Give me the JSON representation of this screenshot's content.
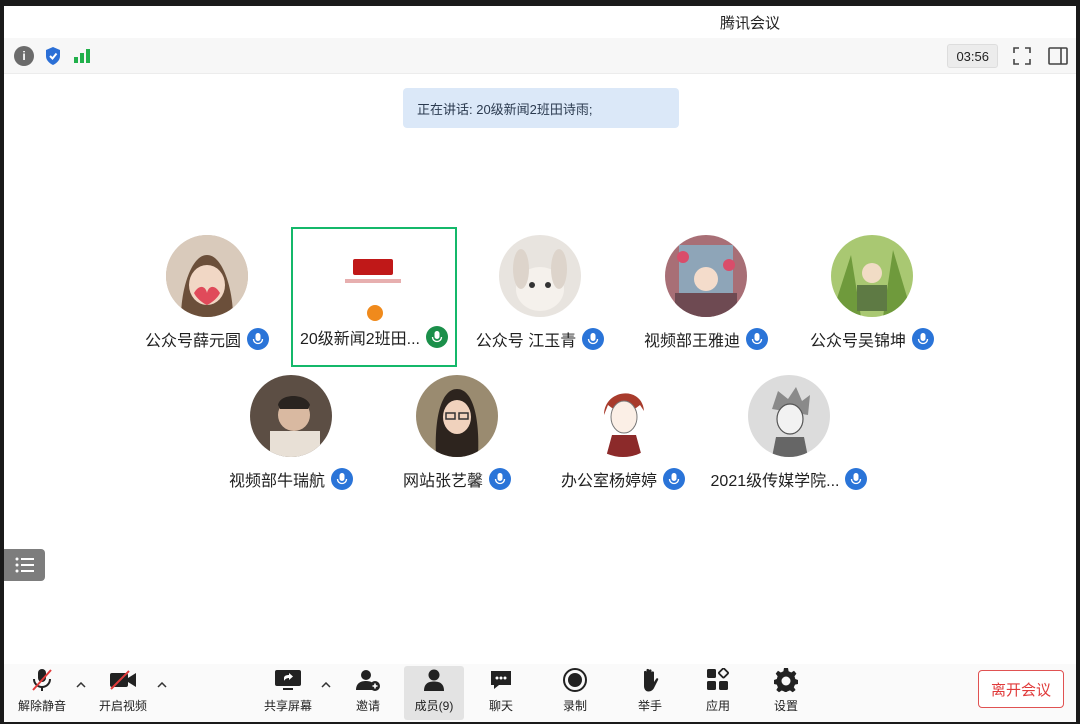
{
  "window": {
    "title": "腾讯会议"
  },
  "infobar": {
    "timer": "03:56"
  },
  "speaking": {
    "text": "正在讲话: 20级新闻2班田诗雨;"
  },
  "participants": [
    {
      "name": "公众号薛元圆",
      "avatar_color": "#c9b7a6"
    },
    {
      "name": "20级新闻2班田...",
      "avatar_color": "#ffffff"
    },
    {
      "name": "公众号 江玉青",
      "avatar_color": "#d9d3cc"
    },
    {
      "name": "视频部王雅迪",
      "avatar_color": "#b27c83"
    },
    {
      "name": "公众号吴锦坤",
      "avatar_color": "#8cb25a"
    },
    {
      "name": "视频部牛瑞航",
      "avatar_color": "#7a6a5e"
    },
    {
      "name": "网站张艺馨",
      "avatar_color": "#8a7a62"
    },
    {
      "name": "办公室杨婷婷",
      "avatar_color": "#f2ece8"
    },
    {
      "name": "2021级传媒学院...",
      "avatar_color": "#d8d8d8"
    }
  ],
  "toolbar": {
    "unmute": "解除静音",
    "video": "开启视频",
    "share": "共享屏幕",
    "invite": "邀请",
    "members": "成员(9)",
    "chat": "聊天",
    "record": "录制",
    "raise_hand": "举手",
    "apps": "应用",
    "settings": "设置",
    "leave": "离开会议"
  },
  "colors": {
    "accent": "#2a74d8",
    "selected_border": "#14b86a",
    "leave": "#e03a3a"
  }
}
